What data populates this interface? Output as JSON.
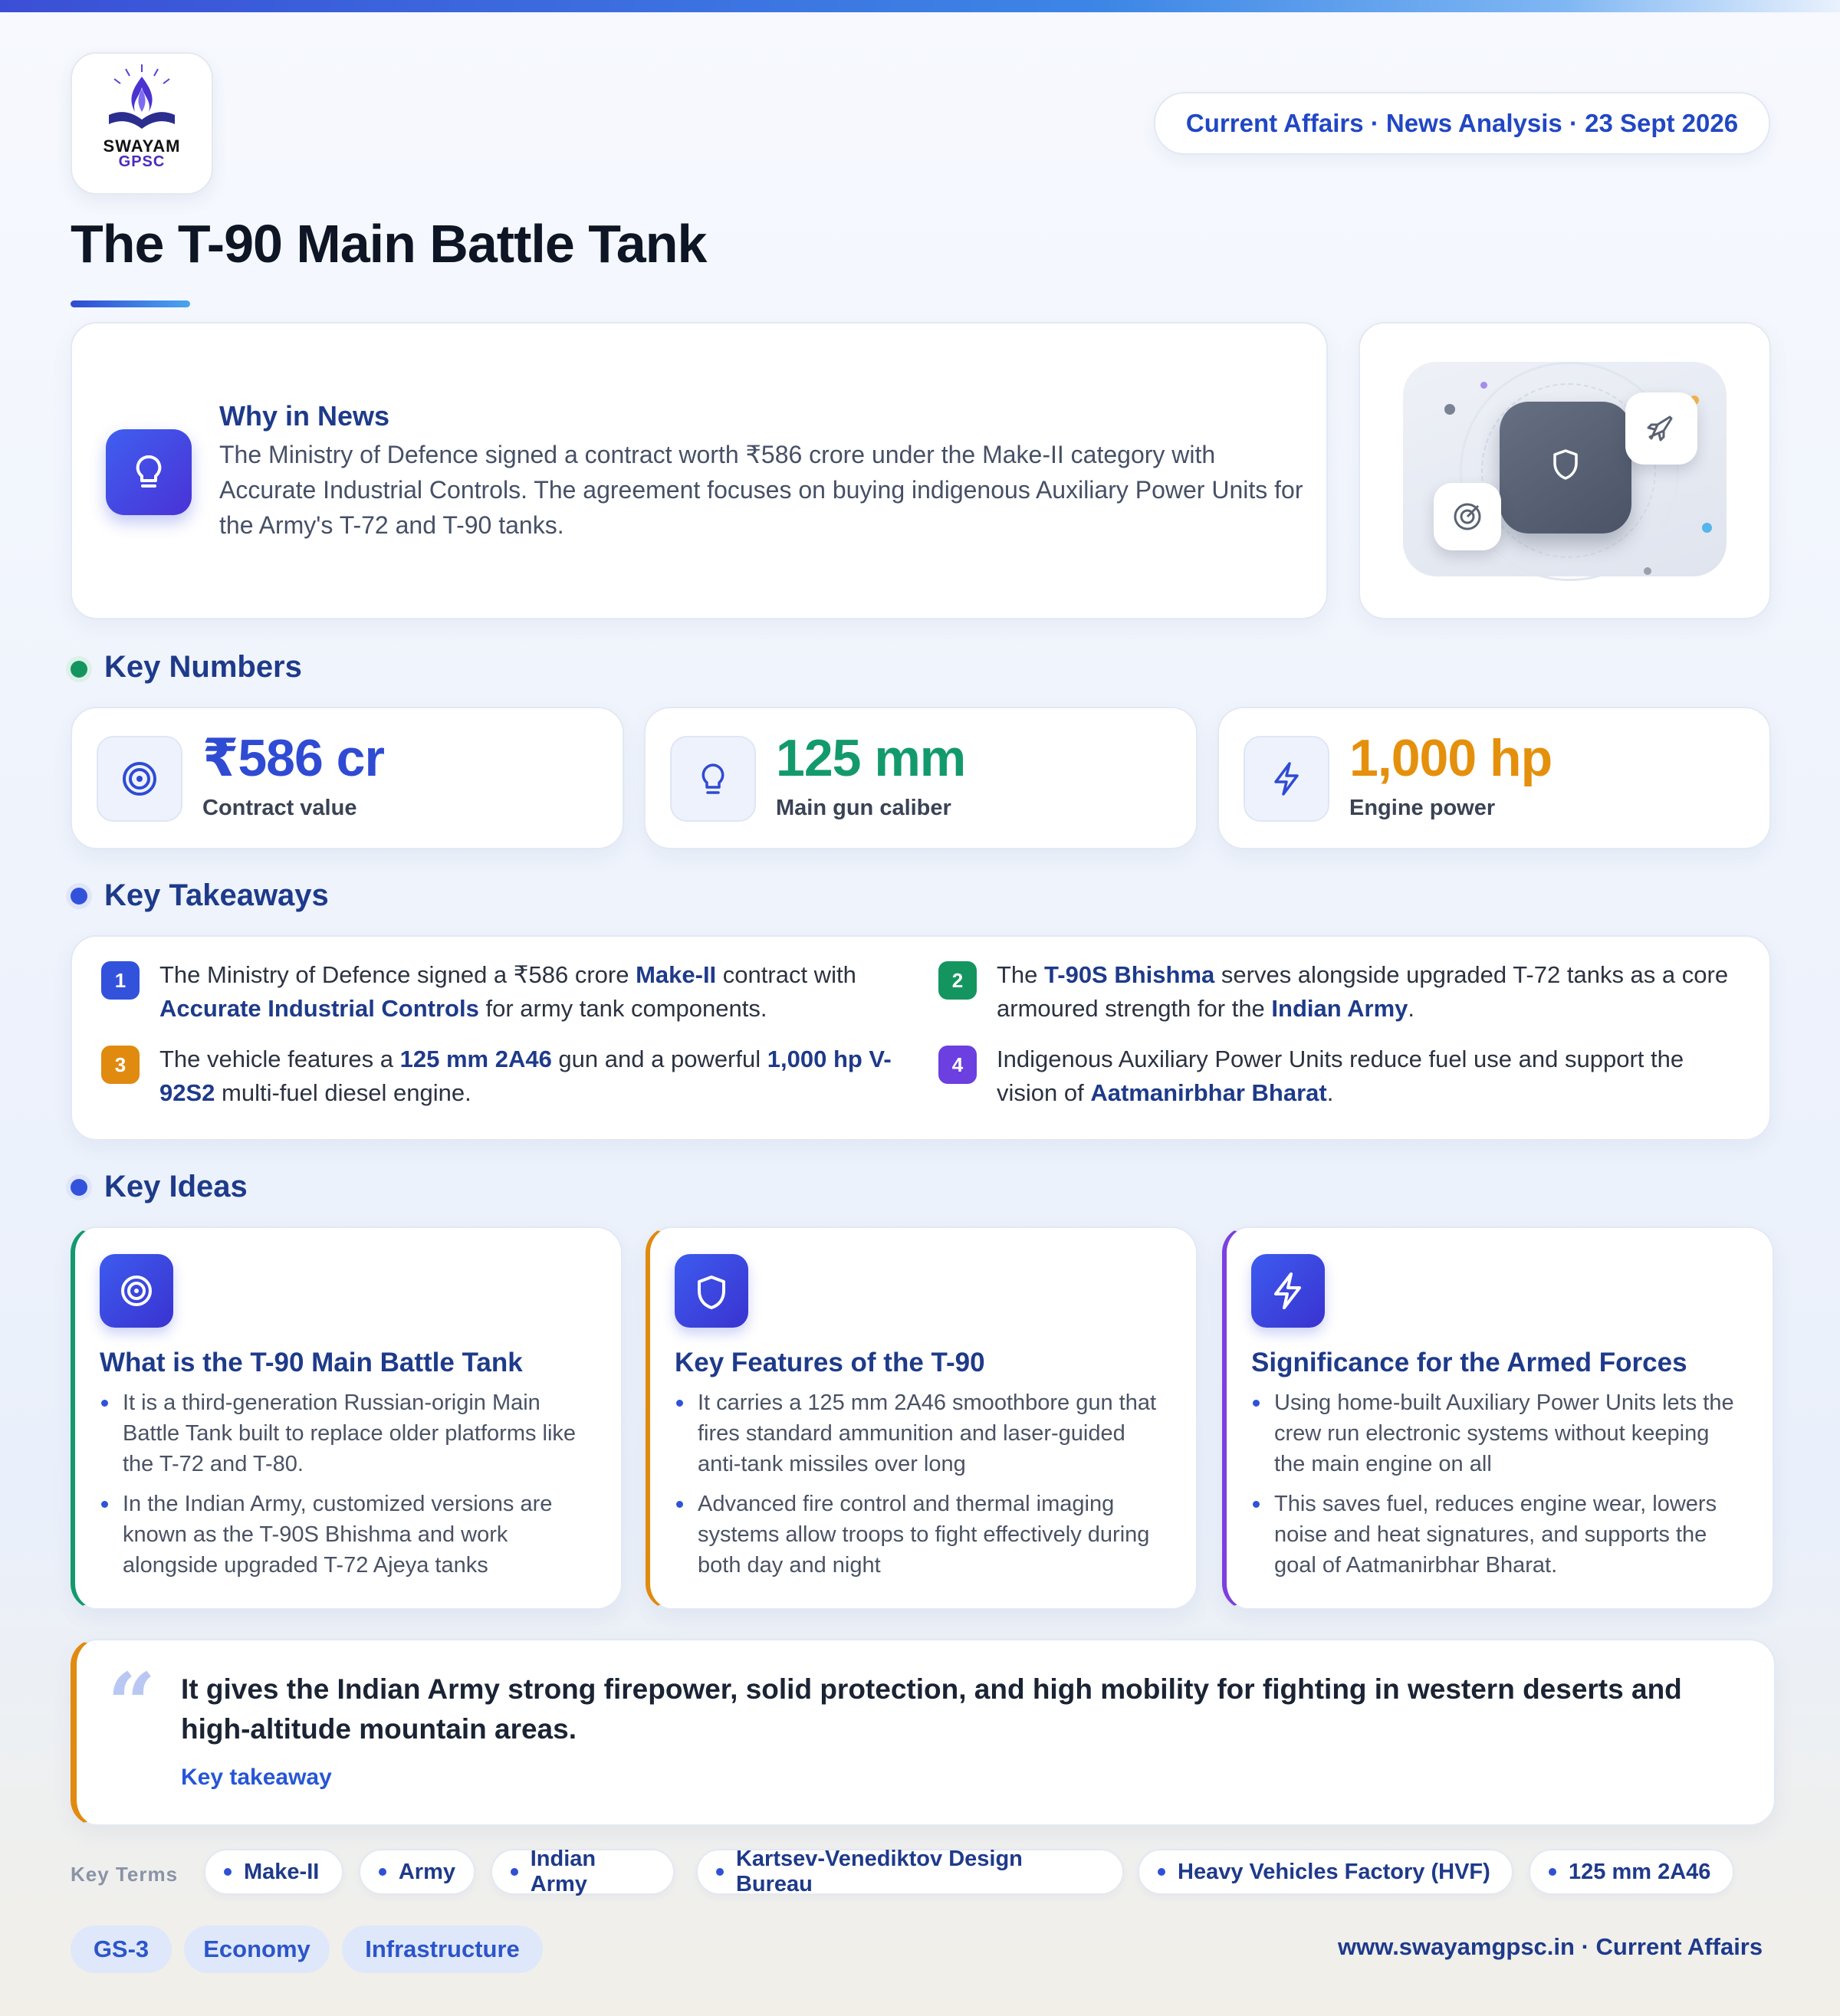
{
  "header": {
    "logo_line1": "SWAYAM",
    "logo_line2": "GPSC",
    "badge": "Current Affairs · News Analysis · 23 Sept 2026",
    "title": "The T-90 Main Battle Tank"
  },
  "why": {
    "title": "Why in News",
    "text": "The Ministry of Defence signed a contract worth ₹586 crore under the Make-II category with Accurate Industrial Controls. The agreement focuses on buying indigenous Auxiliary Power Units for the Army's T-72 and T-90 tanks."
  },
  "sections": {
    "numbers": "Key Numbers",
    "takeaways": "Key Takeaways",
    "ideas": "Key Ideas"
  },
  "stats": [
    {
      "value": "₹586 cr",
      "label": "Contract value",
      "color": "#2f4bd3",
      "icon": "target-icon"
    },
    {
      "value": "125 mm",
      "label": "Main gun caliber",
      "color": "#139a6c",
      "icon": "lightbulb-icon"
    },
    {
      "value": "1,000 hp",
      "label": "Engine power",
      "color": "#e5900c",
      "icon": "lightning-icon"
    }
  ],
  "takeaways": [
    {
      "n": "1",
      "color": "#3352dc",
      "a": "The Ministry of Defence signed a ₹586 crore ",
      "b1": "Make-II",
      "c": " contract with ",
      "b2": "Accurate Industrial Controls",
      "d": " for army tank components."
    },
    {
      "n": "2",
      "color": "#14955f",
      "a": "The ",
      "b1": "T-90S Bhishma",
      "c": " serves alongside upgraded T-72 tanks as a core armoured strength for the ",
      "b2": "Indian Army",
      "d": "."
    },
    {
      "n": "3",
      "color": "#e08a10",
      "a": "The vehicle features a ",
      "b1": "125 mm 2A46",
      "c": " gun and a powerful ",
      "b2": "1,000 hp V-92S2",
      "d": " multi-fuel diesel engine."
    },
    {
      "n": "4",
      "color": "#6b3fe0",
      "a": "Indigenous Auxiliary Power Units reduce fuel use and support the vision of ",
      "b1": "Aatmanirbhar Bharat",
      "c": ".",
      "b2": "",
      "d": ""
    }
  ],
  "ideas": [
    {
      "title": "What is the T-90 Main Battle Tank",
      "accent": "#129a6c",
      "icon": "target-icon",
      "points": [
        "It is a third-generation Russian-origin Main Battle Tank built to replace older platforms like the T-72 and T-80.",
        "In the Indian Army, customized versions are known as the T-90S Bhishma and work alongside upgraded T-72 Ajeya tanks"
      ]
    },
    {
      "title": "Key Features of the T-90",
      "accent": "#e08a10",
      "icon": "shield-icon",
      "points": [
        "It carries a 125 mm 2A46 smoothbore gun that fires standard ammunition and laser-guided anti-tank missiles over long",
        "Advanced fire control and thermal imaging systems allow troops to fight effectively during both day and night"
      ]
    },
    {
      "title": "Significance for the Armed Forces",
      "accent": "#7c3fe0",
      "icon": "lightning-icon",
      "points": [
        "Using home-built Auxiliary Power Units lets the crew run electronic systems without keeping the main engine on all",
        "This saves fuel, reduces engine wear, lowers noise and heat signatures, and supports the goal of Aatmanirbhar Bharat."
      ]
    }
  ],
  "quote": {
    "text": "It gives the Indian Army strong firepower, solid protection, and high mobility for fighting in western deserts and high-altitude mountain areas.",
    "label": "Key takeaway"
  },
  "terms": {
    "label": "Key Terms",
    "items": [
      "Make-II",
      "Army",
      "Indian Army",
      "Kartsev-Venediktov Design Bureau",
      "Heavy Vehicles Factory (HVF)",
      "125 mm 2A46"
    ]
  },
  "tags": [
    "GS-3",
    "Economy",
    "Infrastructure"
  ],
  "footer": "www.swayamgpsc.in · Current Affairs"
}
